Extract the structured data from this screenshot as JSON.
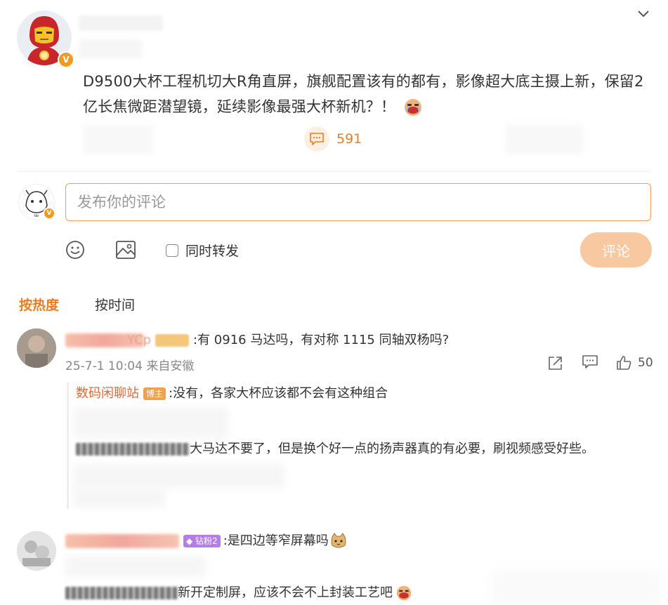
{
  "post": {
    "text": "D9500大杯工程机切大R角直屏，旗舰配置该有的都有，影像超大底主摄上新，保留2亿长焦微距潜望镜，延续影像最强大杯新机？！",
    "comment_count": "591",
    "verified_badge": "V"
  },
  "compose": {
    "placeholder": "发布你的评论",
    "repost_label": "同时转发",
    "submit_label": "评论"
  },
  "sort": {
    "hot_label": "按热度",
    "time_label": "按时间"
  },
  "comments": [
    {
      "name_fragment": "YCp",
      "text": ":有 0916 马达吗，有对称 1115 同轴双杨吗?",
      "time": "25-7-1 10:04",
      "location": "来自安徽",
      "likes": "50",
      "replies": [
        {
          "name": "数码闲聊站",
          "badge": "博主",
          "text": ":没有，各家大杯应该都不会有这种组合"
        },
        {
          "text": "大马达不要了，但是换个好一点的扬声器真的有必要，刷视频感受好些。"
        }
      ]
    },
    {
      "badge": "钻粉2",
      "text": ":是四边等窄屏幕吗",
      "reply_text": "新开定制屏，应该不会不上封装工艺吧"
    }
  ],
  "colors": {
    "accent": "#f07c1a",
    "input_border": "#f2a04d",
    "submit_bg": "#f8c9a0",
    "host_badge": "#f0a14c",
    "fan_badge": "#b67dea",
    "reply_name": "#e06a36"
  }
}
